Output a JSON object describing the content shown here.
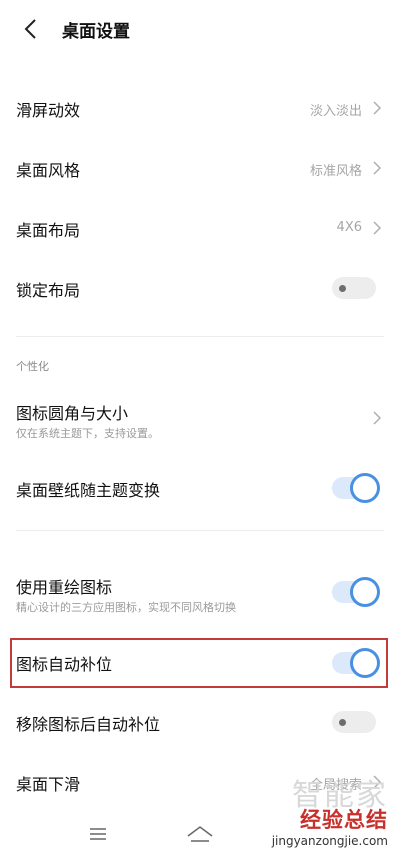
{
  "header": {
    "title": "桌面设置"
  },
  "settings": {
    "scroll_effect": {
      "label": "滑屏动效",
      "value": "淡入淡出"
    },
    "desktop_style": {
      "label": "桌面风格",
      "value": "标准风格"
    },
    "desktop_layout": {
      "label": "桌面布局",
      "value": "4X6"
    },
    "lock_layout": {
      "label": "锁定布局",
      "enabled": false
    }
  },
  "personalization": {
    "section_label": "个性化",
    "icon_corner_size": {
      "label": "图标圆角与大小",
      "subtitle": "仅在系统主题下，支持设置。"
    },
    "wallpaper_follow_theme": {
      "label": "桌面壁纸随主题变换",
      "enabled": true
    },
    "redraw_icons": {
      "label": "使用重绘图标",
      "subtitle": "精心设计的三方应用图标，实现不同风格切换",
      "enabled": true
    },
    "auto_fill_icons": {
      "label": "图标自动补位",
      "enabled": true
    },
    "auto_fill_after_remove": {
      "label": "移除图标后自动补位",
      "enabled": false
    },
    "desktop_swipe_down": {
      "label": "桌面下滑",
      "value": "全局搜索"
    }
  },
  "watermark": {
    "brand": "经验总结",
    "site": "jingyanzongjie.com",
    "overlay": "智能家"
  },
  "colors": {
    "accent": "#4a90e2",
    "highlight_border": "#c33a3a"
  }
}
